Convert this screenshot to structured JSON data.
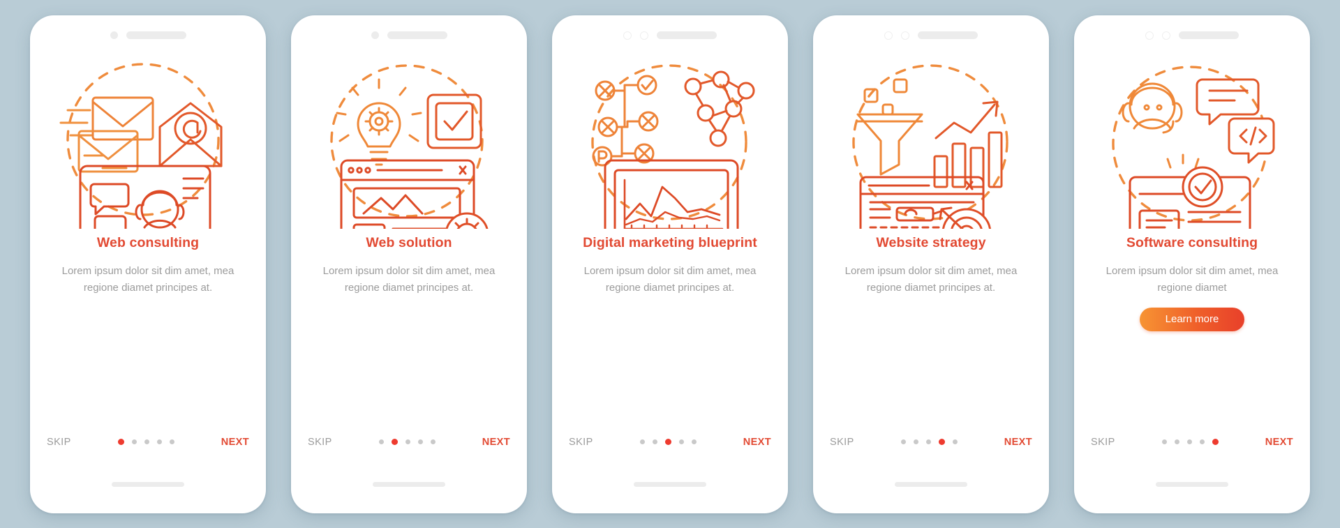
{
  "background_color": "#b9ccd6",
  "theme": {
    "accent": "#e24a33",
    "accent_dot": "#ee3b2f",
    "orange_light": "#f08a3c",
    "orange_mid": "#e8692f",
    "orange_deep": "#d9451f",
    "muted_text": "#9b9b9b",
    "placeholder_gray": "#ececec",
    "button_gradient_from": "#f79433",
    "button_gradient_to": "#e8402a"
  },
  "common": {
    "skip_label": "SKIP",
    "next_label": "NEXT",
    "description": "Lorem ipsum dolor sit dim amet, mea regione diamet principes at.",
    "description_short": "Lorem ipsum dolor sit dim amet, mea regione diamet",
    "total_steps": 5
  },
  "screens": [
    {
      "id": "web-consulting",
      "title": "Web consulting",
      "description": "Lorem ipsum dolor sit dim amet, mea regione diamet principes at.",
      "active_dot": 1,
      "skip_label": "SKIP",
      "next_label": "NEXT",
      "illustration": "envelopes-monitor-support-icon",
      "statusbar_style": "dot-pill",
      "has_learn_more": false
    },
    {
      "id": "web-solution",
      "title": "Web solution",
      "description": "Lorem ipsum dolor sit dim amet, mea regione diamet principes at.",
      "active_dot": 2,
      "skip_label": "SKIP",
      "next_label": "NEXT",
      "illustration": "lightbulb-gear-browser-icon",
      "statusbar_style": "dot-pill",
      "has_learn_more": false
    },
    {
      "id": "digital-marketing-blueprint",
      "title": "Digital marketing blueprint",
      "description": "Lorem ipsum dolor sit dim amet, mea regione diamet principes at.",
      "active_dot": 3,
      "skip_label": "SKIP",
      "next_label": "NEXT",
      "illustration": "flowchart-network-chart-monitor-icon",
      "statusbar_style": "two-rings-pill",
      "has_learn_more": false
    },
    {
      "id": "website-strategy",
      "title": "Website strategy",
      "description": "Lorem ipsum dolor sit dim amet, mea regione diamet principes at.",
      "active_dot": 4,
      "skip_label": "SKIP",
      "next_label": "NEXT",
      "illustration": "funnel-bargraph-target-browser-icon",
      "statusbar_style": "two-rings-pill",
      "has_learn_more": false
    },
    {
      "id": "software-consulting",
      "title": "Software consulting",
      "description": "Lorem ipsum dolor sit dim amet, mea regione diamet",
      "active_dot": 5,
      "skip_label": "SKIP",
      "next_label": "NEXT",
      "learn_more_label": "Learn more",
      "illustration": "headset-code-laptop-check-icon",
      "statusbar_style": "two-rings-pill",
      "has_learn_more": true
    }
  ]
}
